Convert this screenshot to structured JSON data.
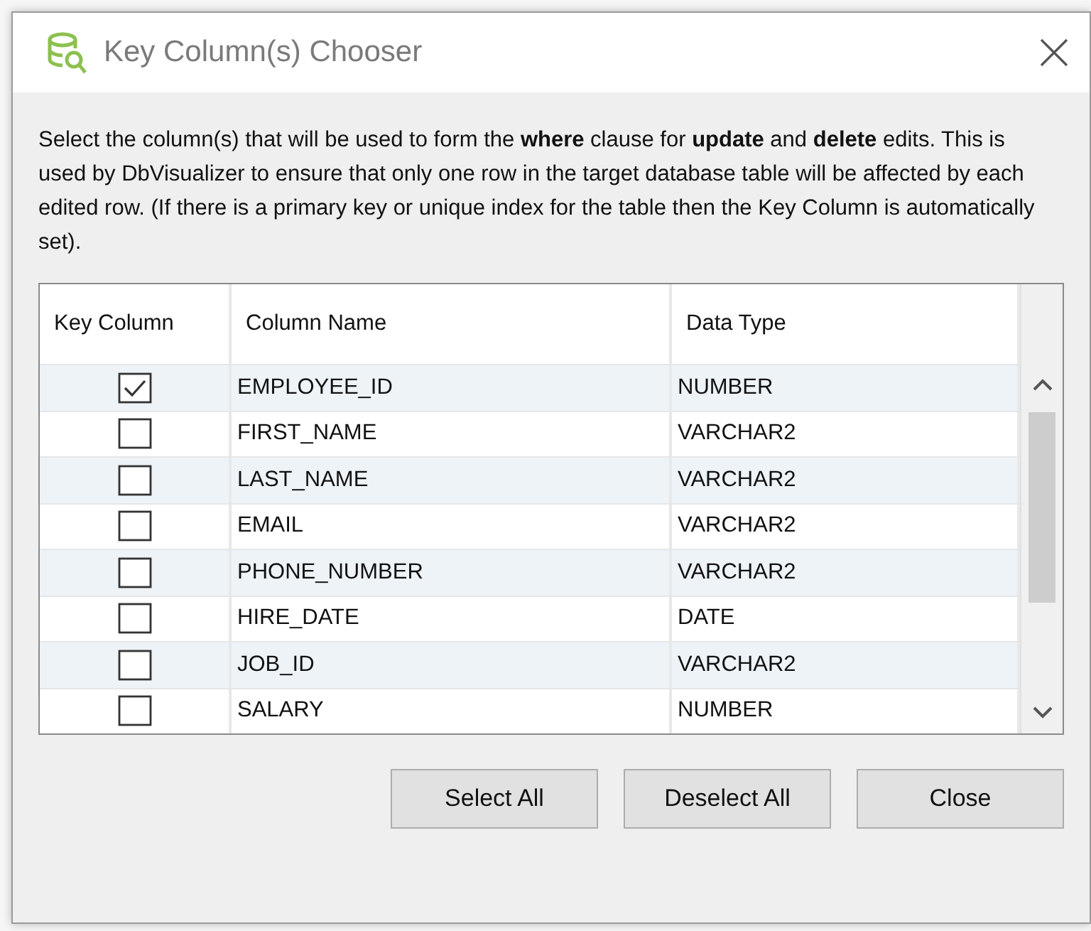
{
  "window": {
    "title": "Key Column(s) Chooser"
  },
  "description": "Select the column(s) that will be used to form the **where** clause for **update** and **delete** edits. This is used by DbVisualizer to ensure that only one row in the target database table will be affected by each edited row. (If there is a primary key or unique index for the table then the Key Column is automatically set).",
  "table": {
    "columns": [
      "Key Column",
      "Column Name",
      "Data Type"
    ],
    "rows": [
      {
        "checked": true,
        "name": "EMPLOYEE_ID",
        "type": "NUMBER"
      },
      {
        "checked": false,
        "name": "FIRST_NAME",
        "type": "VARCHAR2"
      },
      {
        "checked": false,
        "name": "LAST_NAME",
        "type": "VARCHAR2"
      },
      {
        "checked": false,
        "name": "EMAIL",
        "type": "VARCHAR2"
      },
      {
        "checked": false,
        "name": "PHONE_NUMBER",
        "type": "VARCHAR2"
      },
      {
        "checked": false,
        "name": "HIRE_DATE",
        "type": "DATE"
      },
      {
        "checked": false,
        "name": "JOB_ID",
        "type": "VARCHAR2"
      },
      {
        "checked": false,
        "name": "SALARY",
        "type": "NUMBER"
      }
    ]
  },
  "buttons": [
    "Select All",
    "Deselect All",
    "Close"
  ]
}
